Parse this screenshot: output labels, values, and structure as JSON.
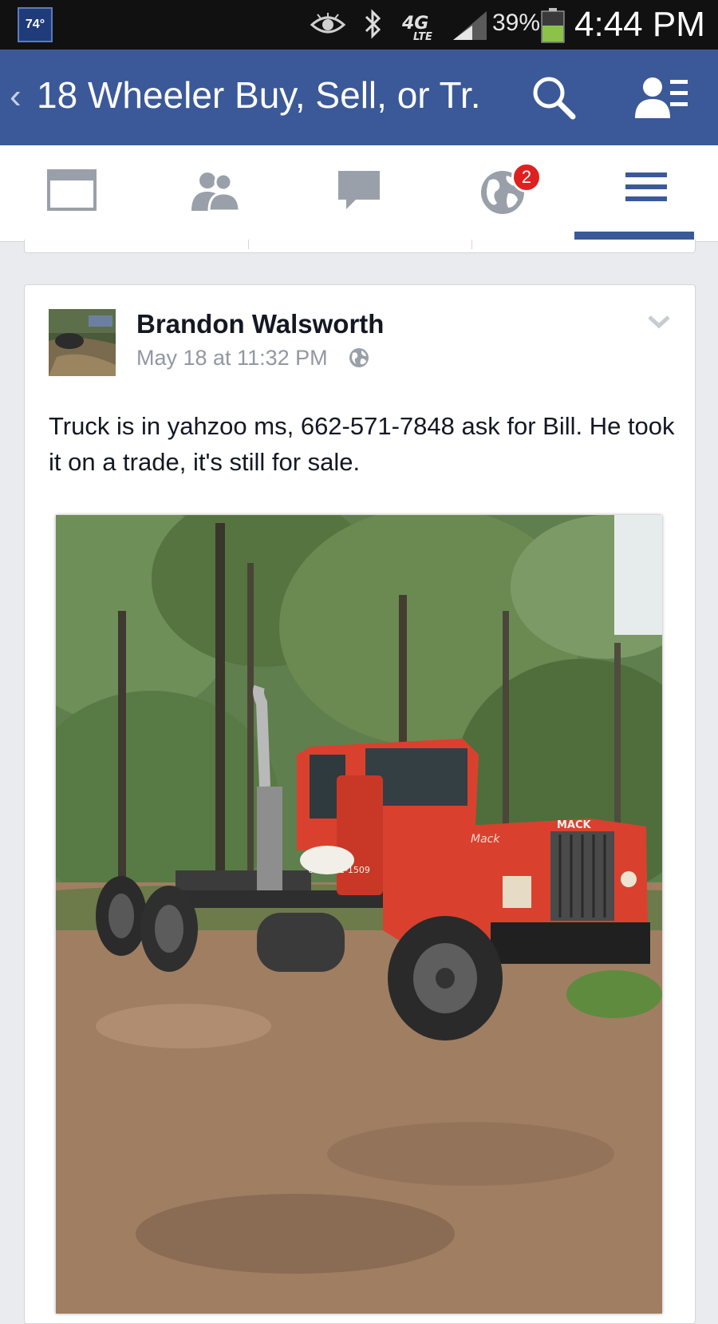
{
  "status_bar": {
    "temperature": "74°",
    "network": "4G LTE",
    "battery": "39%",
    "time": "4:44 PM"
  },
  "header": {
    "back_icon": "chevron-left",
    "title": "18 Wheeler Buy, Sell, or Tr...",
    "search_icon": "search",
    "members_icon": "members-list"
  },
  "nav": {
    "tabs": [
      {
        "name": "news-feed",
        "icon": "news-feed"
      },
      {
        "name": "friend-requests",
        "icon": "people"
      },
      {
        "name": "messages",
        "icon": "chat-bubble"
      },
      {
        "name": "notifications",
        "icon": "globe",
        "badge": "2"
      },
      {
        "name": "more",
        "icon": "hamburger",
        "active": true
      }
    ]
  },
  "post": {
    "author": "Brandon Walsworth",
    "timestamp": "May 18 at 11:32 PM",
    "privacy_icon": "globe",
    "text": "Truck is in yahzoo ms, 662-571-7848 ask for Bill. He took it on a trade, it's still for sale.",
    "photo": {
      "description_icon": "red-mack-truck-photo",
      "cab_text": "601-431-1509",
      "hood_text": "MACK"
    }
  },
  "colors": {
    "facebook_blue": "#3b5998",
    "background": "#e9ebee",
    "badge_red": "#e02020",
    "truck_red": "#d9412e"
  }
}
